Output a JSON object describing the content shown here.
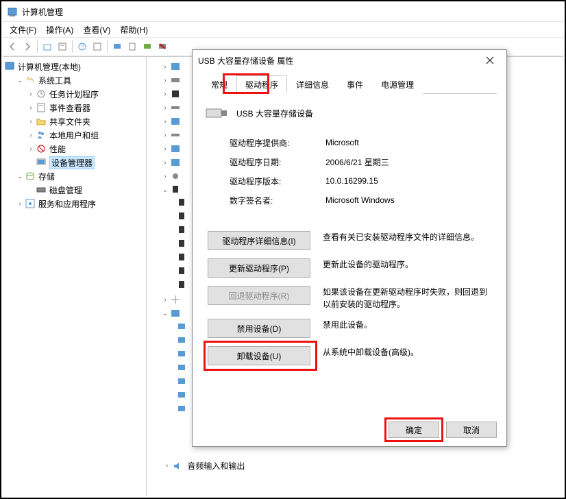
{
  "window": {
    "title": "计算机管理"
  },
  "menubar": {
    "file": "文件(F)",
    "action": "操作(A)",
    "view": "查看(V)",
    "help": "帮助(H)"
  },
  "tree": {
    "root": "计算机管理(本地)",
    "system_tools": "系统工具",
    "task_scheduler": "任务计划程序",
    "event_viewer": "事件查看器",
    "shared_folders": "共享文件夹",
    "local_users": "本地用户和组",
    "performance": "性能",
    "device_manager": "设备管理器",
    "storage": "存储",
    "disk_management": "磁盘管理",
    "services_apps": "服务和应用程序"
  },
  "main": {
    "bottom_item": "音频输入和输出"
  },
  "dialog": {
    "title": "USB 大容量存储设备 属性",
    "tabs": {
      "general": "常规",
      "driver": "驱动程序",
      "details": "详细信息",
      "events": "事件",
      "power": "电源管理"
    },
    "device_name": "USB 大容量存储设备",
    "info": {
      "provider_label": "驱动程序提供商:",
      "provider_value": "Microsoft",
      "date_label": "驱动程序日期:",
      "date_value": "2006/6/21 星期三",
      "version_label": "驱动程序版本:",
      "version_value": "10.0.16299.15",
      "signer_label": "数字签名者:",
      "signer_value": "Microsoft Windows"
    },
    "actions": {
      "details_btn": "驱动程序详细信息(I)",
      "details_desc": "查看有关已安装驱动程序文件的详细信息。",
      "update_btn": "更新驱动程序(P)",
      "update_desc": "更新此设备的驱动程序。",
      "rollback_btn": "回退驱动程序(R)",
      "rollback_desc": "如果该设备在更新驱动程序时失败，则回退到以前安装的驱动程序。",
      "disable_btn": "禁用设备(D)",
      "disable_desc": "禁用此设备。",
      "uninstall_btn": "卸载设备(U)",
      "uninstall_desc": "从系统中卸载设备(高级)。"
    },
    "ok": "确定",
    "cancel": "取消"
  }
}
